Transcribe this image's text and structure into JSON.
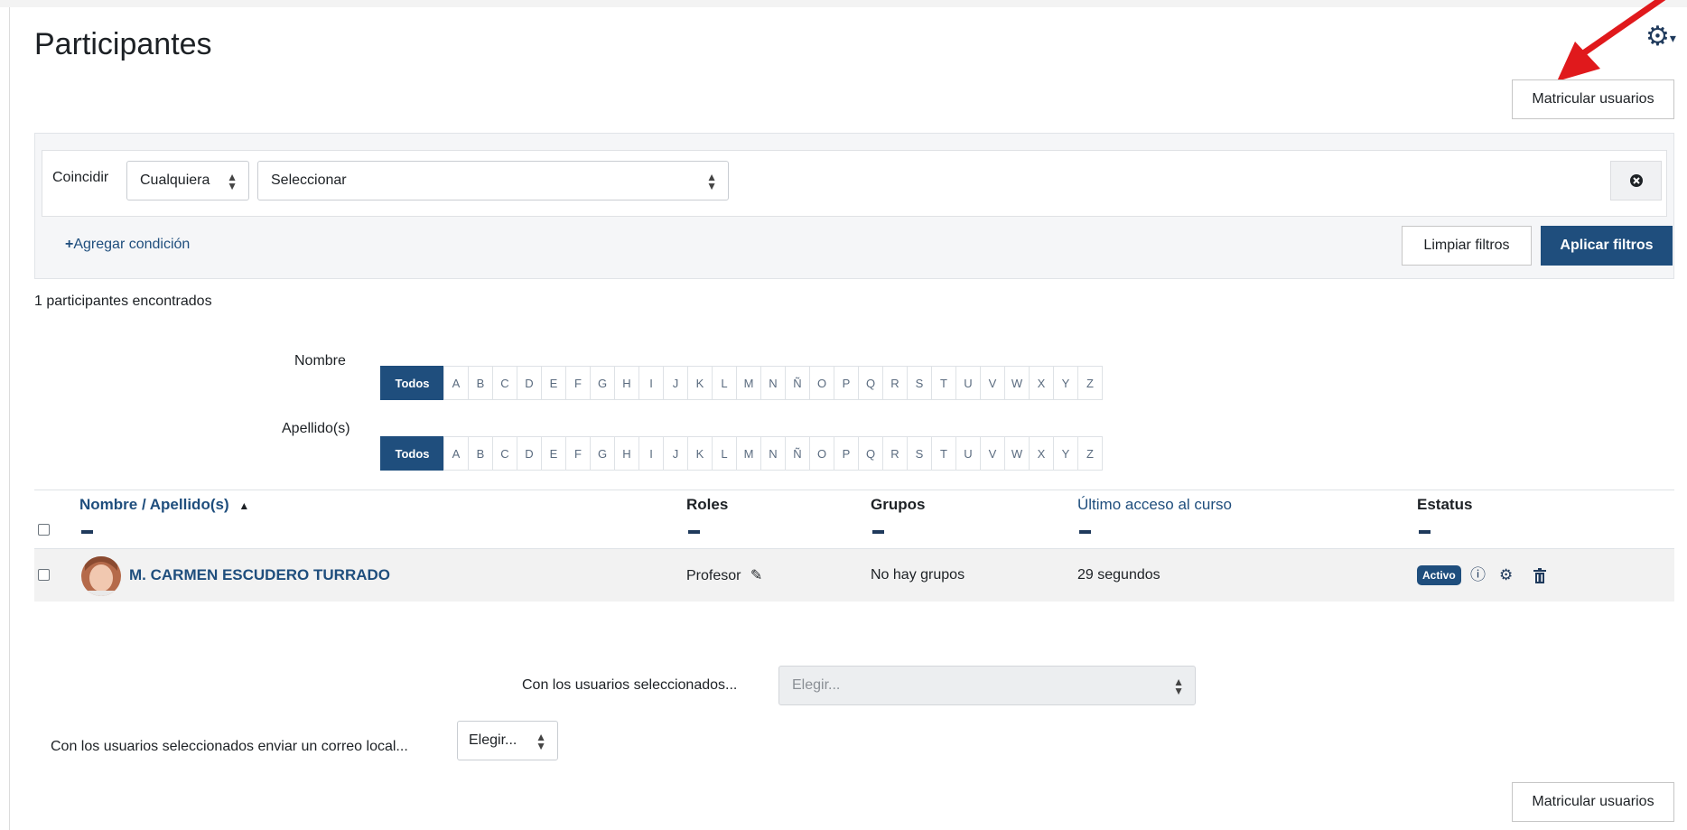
{
  "page": {
    "title": "Participantes"
  },
  "buttons": {
    "enrol_top": "Matricular usuarios",
    "enrol_bottom": "Matricular usuarios",
    "clear_filters": "Limpiar filtros",
    "apply_filters": "Aplicar filtros"
  },
  "filters": {
    "match_label": "Coincidir",
    "match_value": "Cualquiera",
    "select_value": "Seleccionar",
    "add_condition": "Agregar condición"
  },
  "results": {
    "count_text": "1 participantes encontrados"
  },
  "initials": {
    "first_label": "Nombre",
    "last_label": "Apellido(s)",
    "all_label": "Todos",
    "letters": [
      "A",
      "B",
      "C",
      "D",
      "E",
      "F",
      "G",
      "H",
      "I",
      "J",
      "K",
      "L",
      "M",
      "N",
      "Ñ",
      "O",
      "P",
      "Q",
      "R",
      "S",
      "T",
      "U",
      "V",
      "W",
      "X",
      "Y",
      "Z"
    ]
  },
  "table": {
    "headers": {
      "name": "Nombre / Apellido(s)",
      "roles": "Roles",
      "groups": "Grupos",
      "last_access": "Último acceso al curso",
      "status": "Estatus"
    },
    "rows": [
      {
        "name": "M. CARMEN ESCUDERO TURRADO",
        "role": "Profesor",
        "groups": "No hay grupos",
        "last_access": "29 segundos",
        "status": "Activo"
      }
    ]
  },
  "bulk": {
    "with_selected_label": "Con los usuarios seleccionados...",
    "with_selected_placeholder": "Elegir...",
    "email_label": "Con los usuarios seleccionados enviar un correo local...",
    "email_placeholder": "Elegir..."
  },
  "colors": {
    "primary": "#1f4e7d",
    "annotation_arrow": "#e0191c"
  }
}
